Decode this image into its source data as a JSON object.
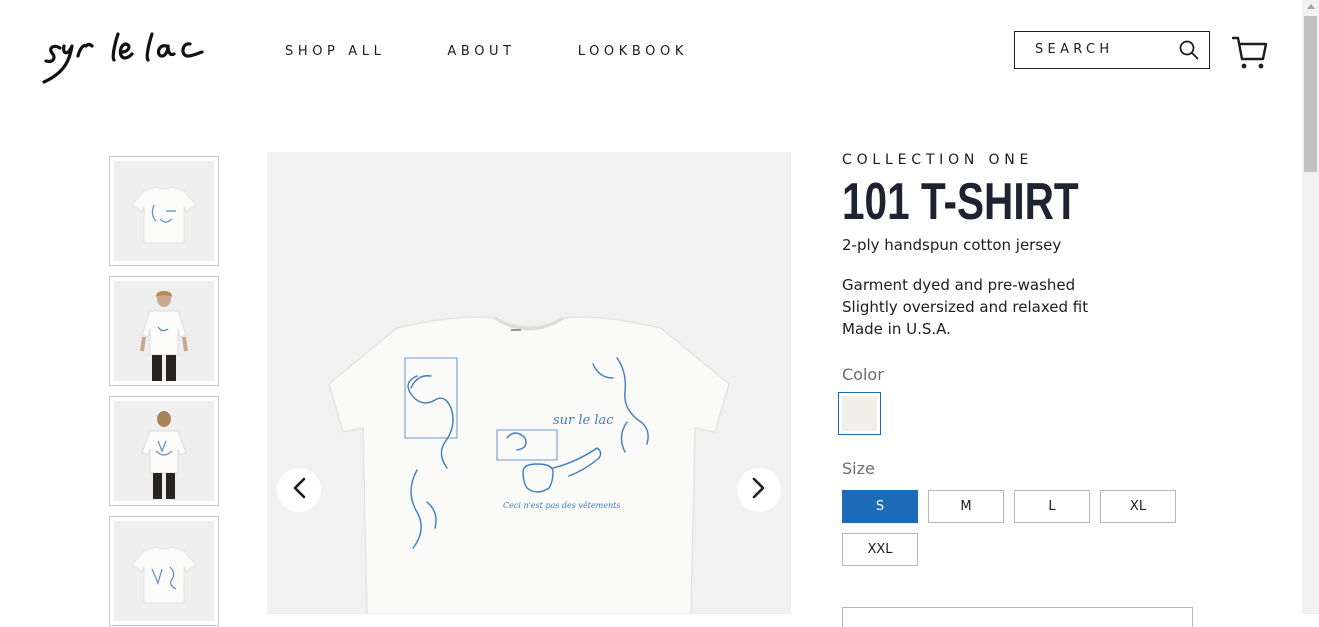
{
  "brand": {
    "logo_text": "sur le lac"
  },
  "nav": {
    "items": [
      "SHOP ALL",
      "ABOUT",
      "LOOKBOOK"
    ]
  },
  "search": {
    "placeholder": "SEARCH"
  },
  "product": {
    "collection": "COLLECTION ONE",
    "title": "101 T-SHIRT",
    "subtitle": "2-ply handspun cotton jersey",
    "description": [
      "Garment dyed and pre-washed",
      "Slightly oversized and relaxed fit",
      "Made in U.S.A."
    ],
    "color_label": "Color",
    "color_swatch": "#f1efea",
    "size_label": "Size",
    "sizes": [
      "S",
      "M",
      "L",
      "XL",
      "XXL"
    ],
    "selected_size": "S",
    "shirt_print_text": "Ceci n'est pas des vêtements",
    "shirt_print_logo": "sur le lac"
  },
  "colors": {
    "accent": "#1b6bb8",
    "title": "#1f2230",
    "print": "#3f7bbf"
  },
  "icons": [
    "search-icon",
    "cart-icon",
    "chevron-left-icon",
    "chevron-right-icon"
  ]
}
